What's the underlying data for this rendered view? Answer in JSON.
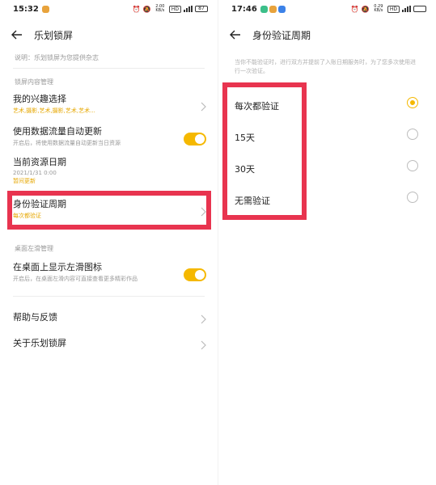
{
  "left": {
    "status": {
      "time": "15:32",
      "speed": "2.00 KB/s",
      "battery": "87"
    },
    "title": "乐划锁屏",
    "description": "说明：乐划锁屏为您提供杂志",
    "section1": "锁屏内容管理",
    "items": [
      {
        "title": "我的兴趣选择",
        "subtitle": "艺术,摄影,艺术,摄影,艺术,艺术..."
      },
      {
        "title": "使用数据流量自动更新",
        "subtitle": "开启后，将使用数据流量自动更新当日资源"
      },
      {
        "title": "当前资源日期",
        "subtitle": "2021/1/31 0:00",
        "subtitle2": "暂间更新"
      },
      {
        "title": "身份验证周期",
        "subtitle": "每次都验证"
      }
    ],
    "section2": "桌面左滑管理",
    "desktop_item": {
      "title": "在桌面上显示左滑图标",
      "subtitle": "开启后，在桌面左滑内容可直接查看更多精彩作品"
    },
    "help": "帮助与反馈",
    "about": "关于乐划锁屏"
  },
  "right": {
    "status": {
      "time": "17:46",
      "speed": "0.29 KB/s"
    },
    "title": "身份验证周期",
    "description": "当你不能验证时，进行双方并提前了入账日期服务时，为了您多次使用进行一次验证。",
    "options": [
      {
        "label": "每次都验证",
        "selected": true
      },
      {
        "label": "15天",
        "selected": false
      },
      {
        "label": "30天",
        "selected": false
      },
      {
        "label": "无需验证",
        "selected": false
      }
    ]
  },
  "colors": {
    "accent": "#f5b800",
    "highlight": "#e8344f"
  }
}
